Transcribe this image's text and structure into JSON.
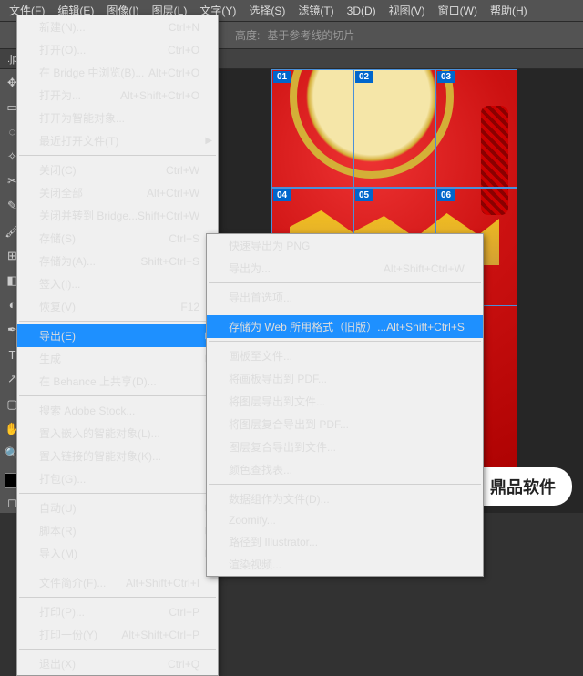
{
  "menubar": [
    "文件(F)",
    "编辑(E)",
    "图像(I)",
    "图层(L)",
    "文字(Y)",
    "选择(S)",
    "滤镜(T)",
    "3D(D)",
    "视图(V)",
    "窗口(W)",
    "帮助(H)"
  ],
  "toolbar": {
    "height_label": "高度:",
    "slice_label": "基于参考线的切片"
  },
  "doctab": ".jpg",
  "file_menu": [
    {
      "l": "新建(N)...",
      "s": "Ctrl+N"
    },
    {
      "l": "打开(O)...",
      "s": "Ctrl+O"
    },
    {
      "l": "在 Bridge 中浏览(B)...",
      "s": "Alt+Ctrl+O"
    },
    {
      "l": "打开为...",
      "s": "Alt+Shift+Ctrl+O"
    },
    {
      "l": "打开为智能对象..."
    },
    {
      "l": "最近打开文件(T)",
      "sub": true
    },
    {
      "sep": true
    },
    {
      "l": "关闭(C)",
      "s": "Ctrl+W"
    },
    {
      "l": "关闭全部",
      "s": "Alt+Ctrl+W"
    },
    {
      "l": "关闭并转到 Bridge...",
      "s": "Shift+Ctrl+W"
    },
    {
      "l": "存储(S)",
      "s": "Ctrl+S"
    },
    {
      "l": "存储为(A)...",
      "s": "Shift+Ctrl+S"
    },
    {
      "l": "签入(I)...",
      "d": true
    },
    {
      "l": "恢复(V)",
      "s": "F12"
    },
    {
      "sep": true
    },
    {
      "l": "导出(E)",
      "sub": true,
      "sel": true
    },
    {
      "l": "生成",
      "sub": true
    },
    {
      "l": "在 Behance 上共享(D)...",
      "d": true
    },
    {
      "sep": true
    },
    {
      "l": "搜索 Adobe Stock..."
    },
    {
      "l": "置入嵌入的智能对象(L)..."
    },
    {
      "l": "置入链接的智能对象(K)..."
    },
    {
      "l": "打包(G)...",
      "d": true
    },
    {
      "sep": true
    },
    {
      "l": "自动(U)",
      "sub": true
    },
    {
      "l": "脚本(R)",
      "sub": true
    },
    {
      "l": "导入(M)",
      "sub": true
    },
    {
      "sep": true
    },
    {
      "l": "文件简介(F)...",
      "s": "Alt+Shift+Ctrl+I"
    },
    {
      "sep": true
    },
    {
      "l": "打印(P)...",
      "s": "Ctrl+P"
    },
    {
      "l": "打印一份(Y)",
      "s": "Alt+Shift+Ctrl+P"
    },
    {
      "sep": true
    },
    {
      "l": "退出(X)",
      "s": "Ctrl+Q"
    }
  ],
  "export_menu": [
    {
      "l": "快速导出为 PNG"
    },
    {
      "l": "导出为...",
      "s": "Alt+Shift+Ctrl+W"
    },
    {
      "sep": true
    },
    {
      "l": "导出首选项..."
    },
    {
      "sep": true
    },
    {
      "l": "存储为 Web 所用格式（旧版）...",
      "s": "Alt+Shift+Ctrl+S",
      "sel": true
    },
    {
      "sep": true
    },
    {
      "l": "画板至文件..."
    },
    {
      "l": "将画板导出到 PDF..."
    },
    {
      "l": "将图层导出到文件..."
    },
    {
      "l": "将图层复合导出到 PDF..."
    },
    {
      "l": "图层复合导出到文件..."
    },
    {
      "l": "颜色查找表..."
    },
    {
      "sep": true
    },
    {
      "l": "数据组作为文件(D)...",
      "d": true
    },
    {
      "l": "Zoomify..."
    },
    {
      "l": "路径到 Illustrator..."
    },
    {
      "l": "渲染视频..."
    }
  ],
  "slices": [
    "01",
    "02",
    "03",
    "04",
    "05",
    "06"
  ],
  "watermark": "鼎品软件"
}
